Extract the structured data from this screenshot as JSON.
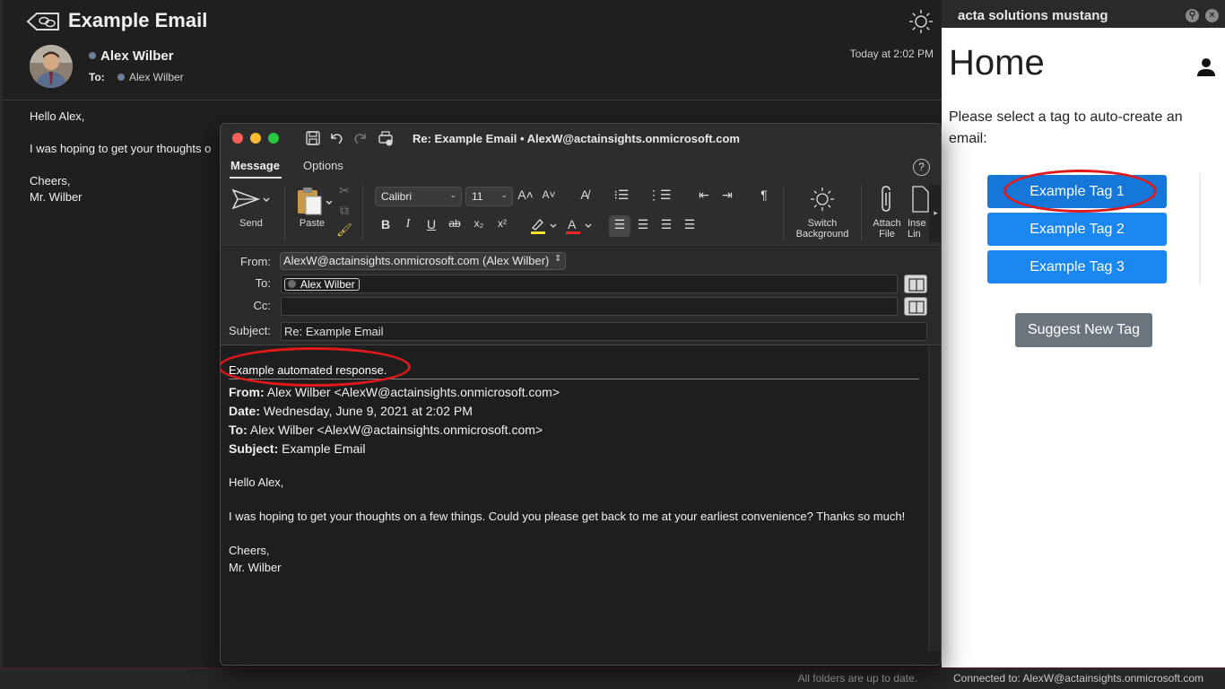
{
  "reading_pane": {
    "title": "Example Email",
    "sender": "Alex Wilber",
    "to_label": "To:",
    "to_value": "Alex Wilber",
    "timestamp": "Today at 2:02 PM",
    "body": {
      "greeting": "Hello Alex,",
      "line": "I was hoping to get your thoughts o",
      "signoff": "Cheers,",
      "signature": "Mr. Wilber"
    }
  },
  "compose": {
    "window_title": "Re: Example Email • AlexW@actainsights.onmicrosoft.com",
    "tabs": {
      "message": "Message",
      "options": "Options"
    },
    "ribbon": {
      "send": "Send",
      "paste": "Paste",
      "font_family": "Calibri",
      "font_size": "11",
      "switch_background_line1": "Switch",
      "switch_background_line2": "Background",
      "attach_line1": "Attach",
      "attach_line2": "File",
      "insert_line1": "Inse",
      "insert_line2": "Lin"
    },
    "fields": {
      "from_label": "From:",
      "from_value": "AlexW@actainsights.onmicrosoft.com (Alex Wilber)",
      "to_label": "To:",
      "to_recipient": "Alex Wilber",
      "cc_label": "Cc:",
      "subject_label": "Subject:",
      "subject_value": "Re: Example Email"
    },
    "body": {
      "automated_response": "Example automated response.",
      "from_label": "From:",
      "from_value": "Alex Wilber <AlexW@actainsights.onmicrosoft.com>",
      "date_label": "Date:",
      "date_value": "Wednesday, June 9, 2021 at 2:02 PM",
      "to_label": "To:",
      "to_value": "Alex Wilber <AlexW@actainsights.onmicrosoft.com>",
      "subject_label": "Subject:",
      "subject_value": "Example Email",
      "greeting": "Hello Alex,",
      "message": "I was hoping to get your thoughts on a few things. Could you please get back to me at your earliest convenience? Thanks so much!",
      "signoff": "Cheers,",
      "signature": "Mr. Wilber"
    }
  },
  "addin": {
    "title": "acta solutions mustang",
    "heading": "Home",
    "prompt": "Please select a tag to auto-create an email:",
    "tags": [
      "Example Tag 1",
      "Example Tag 2",
      "Example Tag 3"
    ],
    "suggest_button": "Suggest New Tag"
  },
  "status_bar": {
    "sync_status": "All folders are up to date.",
    "connection": "Connected to: AlexW@actainsights.onmicrosoft.com"
  },
  "colors": {
    "tag_button": "#1a86f0",
    "suggest_button": "#6c757d",
    "annotation_oval": "#e0191c",
    "window_background": "#1e1e1e"
  }
}
